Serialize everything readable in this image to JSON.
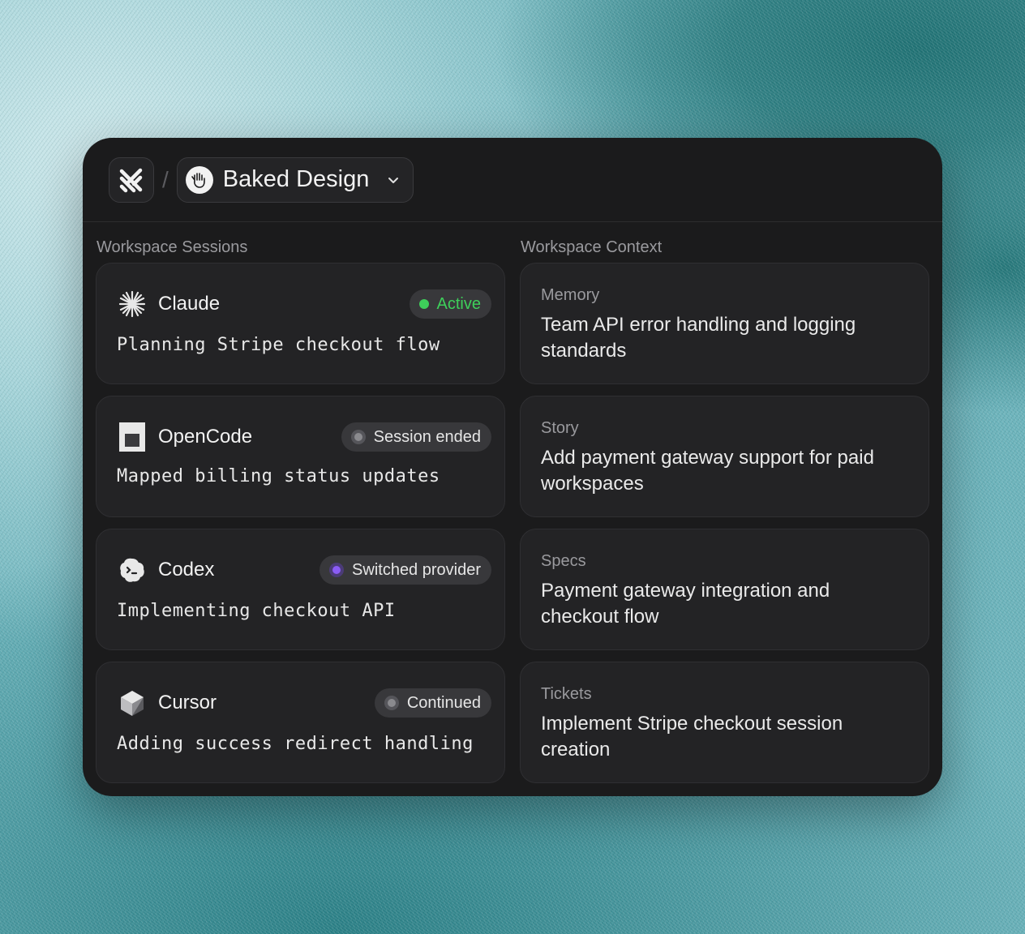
{
  "header": {
    "workspace_name": "Baked Design",
    "separator": "/"
  },
  "sessions": {
    "title": "Workspace Sessions",
    "items": [
      {
        "agent": "Claude",
        "status": "Active",
        "status_color": "#3ecf5a",
        "task": "Planning Stripe checkout flow",
        "icon": "claude-icon"
      },
      {
        "agent": "OpenCode",
        "status": "Session ended",
        "status_color": "#9a9a9e",
        "task": "Mapped billing status updates",
        "icon": "opencode-icon"
      },
      {
        "agent": "Codex",
        "status": "Switched provider",
        "status_color": "#8b5cf6",
        "task": "Implementing checkout API",
        "icon": "codex-icon"
      },
      {
        "agent": "Cursor",
        "status": "Continued",
        "status_color": "#9a9a9e",
        "task": "Adding success redirect handling",
        "icon": "cursor-icon"
      }
    ]
  },
  "context": {
    "title": "Workspace Context",
    "items": [
      {
        "label": "Memory",
        "text": "Team API error handling and logging standards"
      },
      {
        "label": "Story",
        "text": "Add payment gateway support for paid workspaces"
      },
      {
        "label": "Specs",
        "text": "Payment gateway integration and checkout flow"
      },
      {
        "label": "Tickets",
        "text": "Implement Stripe checkout session creation"
      }
    ]
  }
}
